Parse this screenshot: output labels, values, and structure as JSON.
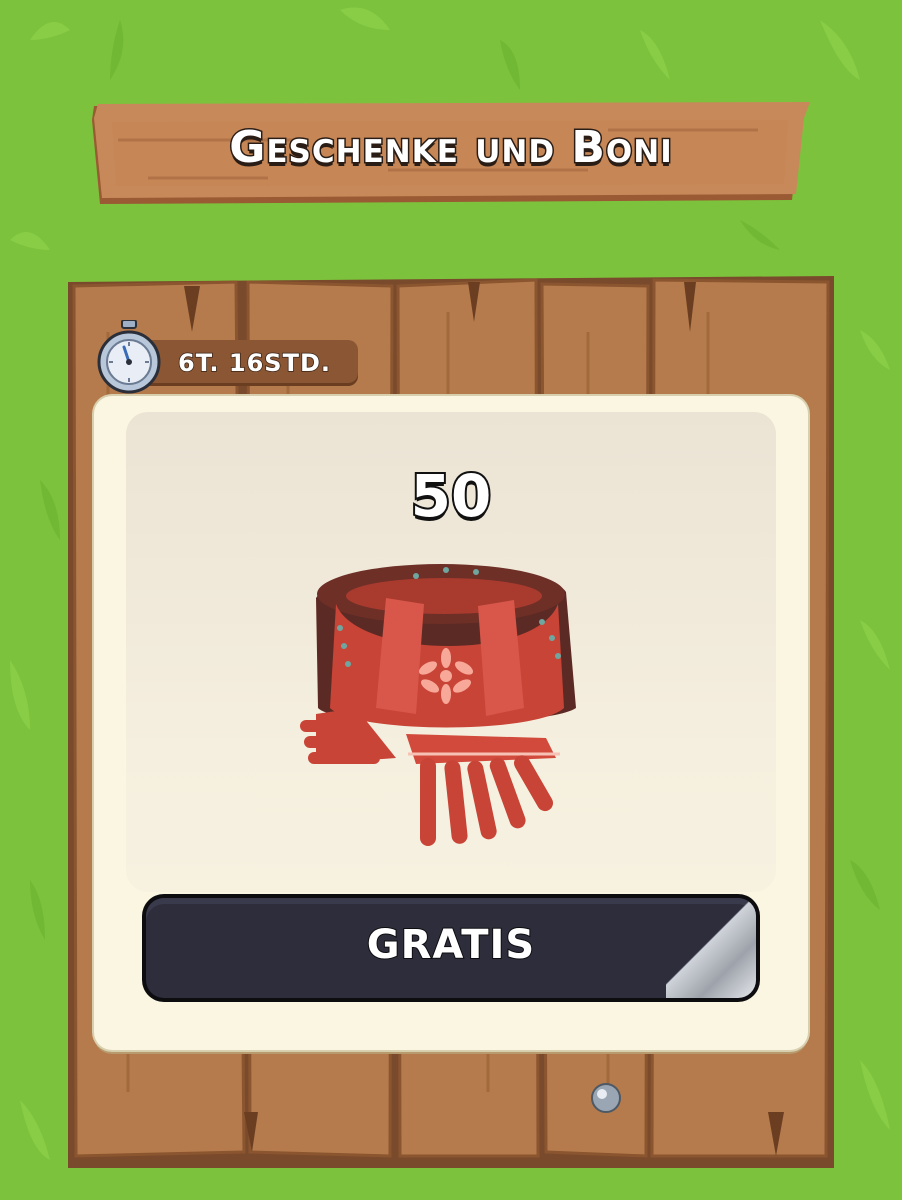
{
  "header": {
    "title": "Geschenke und Boni"
  },
  "offer": {
    "timer_text": "6T. 16STD.",
    "amount": "50",
    "item_icon": "scarf-icon",
    "button_label": "GRATIS"
  },
  "colors": {
    "grass": "#7cc23c",
    "wood": "#b07a4a",
    "card": "#fbf6e2",
    "button": "#2d2d3c"
  }
}
